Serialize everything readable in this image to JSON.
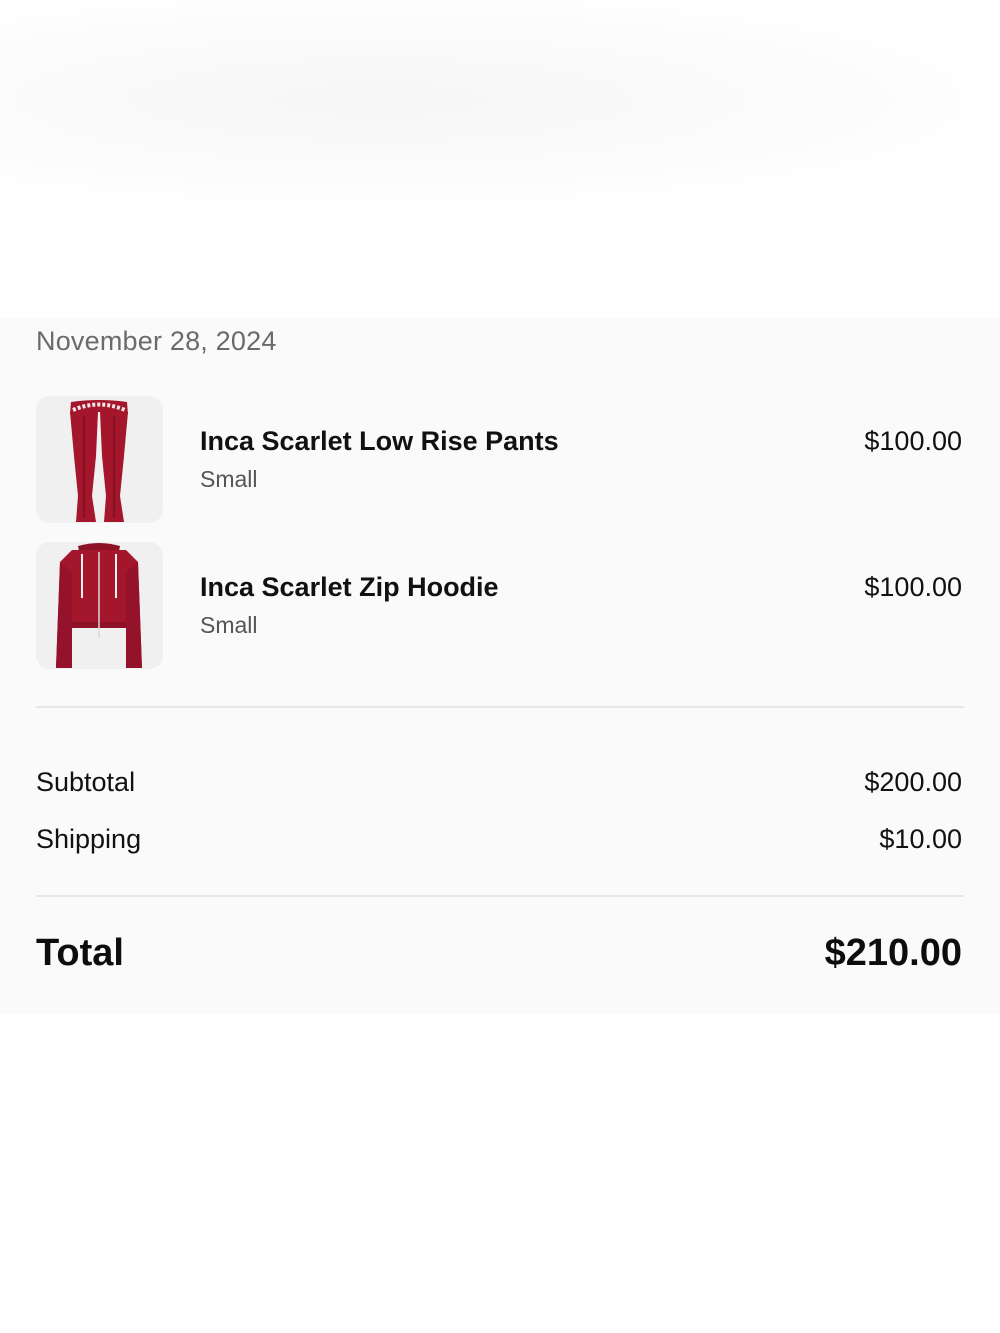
{
  "order": {
    "date": "November 28, 2024"
  },
  "items": [
    {
      "name": "Inca Scarlet Low Rise Pants",
      "variant": "Small",
      "price": "$100.00",
      "image_icon": "red-pants-thumbnail",
      "image_color": "#a3162c"
    },
    {
      "name": "Inca Scarlet Zip Hoodie",
      "variant": "Small",
      "price": "$100.00",
      "image_icon": "red-hoodie-thumbnail",
      "image_color": "#a3162c"
    }
  ],
  "summary": {
    "subtotal_label": "Subtotal",
    "subtotal_value": "$200.00",
    "shipping_label": "Shipping",
    "shipping_value": "$10.00",
    "total_label": "Total",
    "total_value": "$210.00"
  }
}
